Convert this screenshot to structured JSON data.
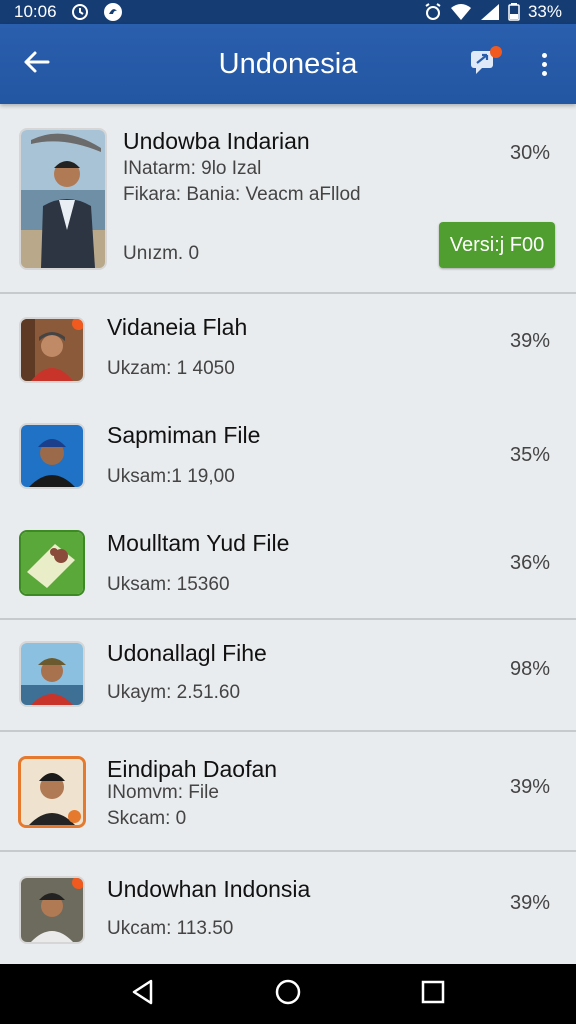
{
  "status_bar": {
    "time": "10:06",
    "battery": "33%"
  },
  "app_bar": {
    "title": "Undonesia"
  },
  "items": [
    {
      "name": "Undowba Indarian",
      "line1": "INatarm: 9lo Izal",
      "line2": "Fikara: Bania: Veacm aFllod",
      "line3": "Unızm. 0",
      "percent": "30%",
      "button_label": "Versi:j F00",
      "thumb": "person-photo"
    },
    {
      "name": "Vidaneia Flah",
      "line1": "Ukzam: 1 4050",
      "percent": "39%",
      "thumb": "person-photo"
    },
    {
      "name": "Sapmiman File",
      "line1": "Uksam:1 19,00",
      "percent": "35%",
      "thumb": "person-photo"
    },
    {
      "name": "Moulltam Yud File",
      "line1": "Uksam: 15360",
      "percent": "36%",
      "thumb": "file-icon"
    },
    {
      "name": "Udonallagl Fihe",
      "line1": "Ukaym: 2.51.60",
      "percent": "98%",
      "thumb": "person-photo"
    },
    {
      "name": "Eindipah Daofan",
      "line1": "INomvm: File",
      "line2": "Skcam: 0",
      "percent": "39%",
      "thumb": "person-photo"
    },
    {
      "name": "Undowhan Indonsia",
      "line1": "Ukcam: 113.50",
      "percent": "39%",
      "thumb": "person-photo"
    }
  ],
  "colors": {
    "app_bar": "#2a5fae",
    "status_bar": "#163d73",
    "verify_button": "#4f9e2f",
    "notification_dot": "#f05a1e",
    "background": "#e9ecee"
  },
  "icons": {
    "back": "arrow-left-icon",
    "share": "share-chat-icon",
    "more": "more-vert-icon",
    "nav_back": "triangle-back-icon",
    "nav_home": "circle-home-icon",
    "nav_recent": "square-recent-icon"
  }
}
